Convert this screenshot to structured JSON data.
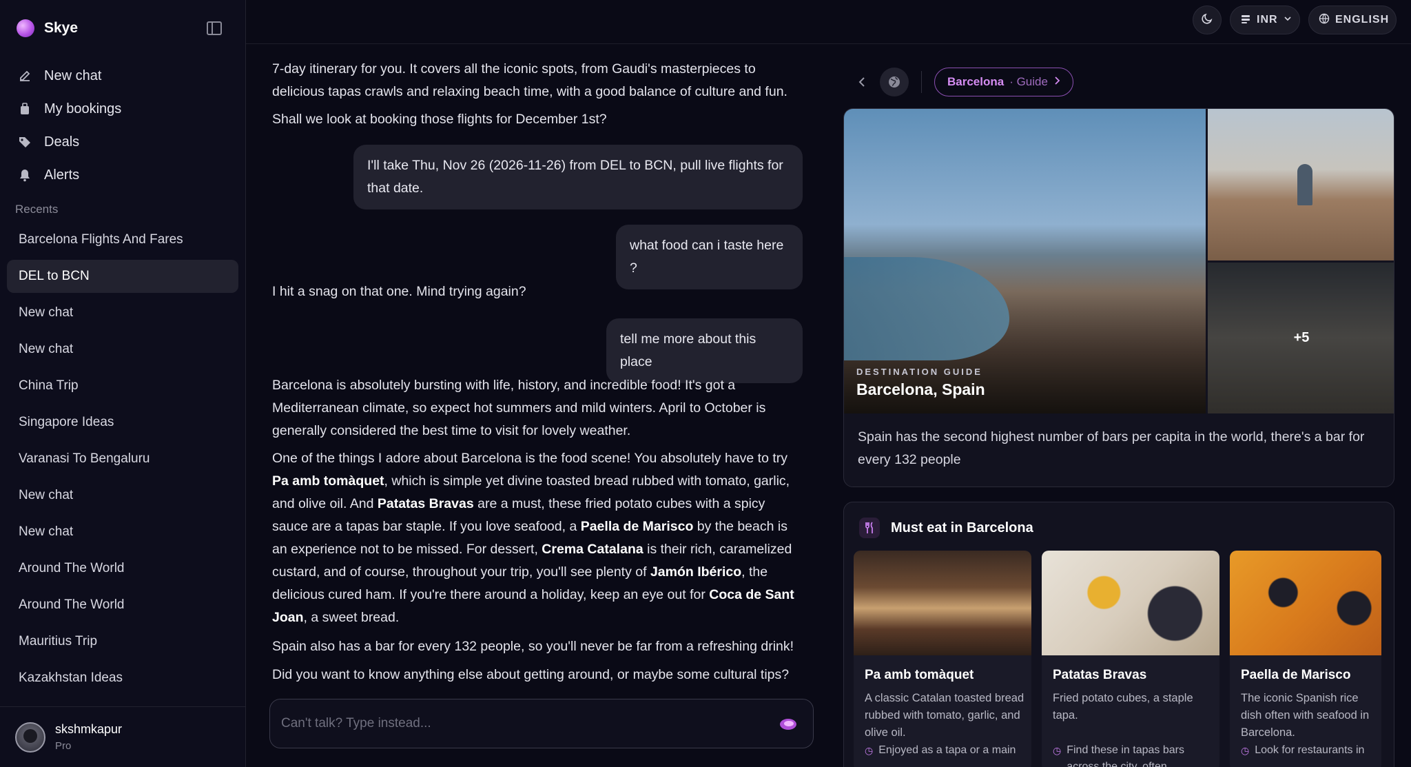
{
  "app": {
    "name": "Skye"
  },
  "nav": [
    {
      "label": "New chat",
      "icon": "edit-icon"
    },
    {
      "label": "My bookings",
      "icon": "suitcase-icon"
    },
    {
      "label": "Deals",
      "icon": "tag-icon"
    },
    {
      "label": "Alerts",
      "icon": "bell-icon"
    }
  ],
  "recents": {
    "label": "Recents",
    "items": [
      "Barcelona Flights And Fares",
      "DEL to BCN",
      "New chat",
      "New chat",
      "China Trip",
      "Singapore Ideas",
      "Varanasi To Bengaluru",
      "New chat",
      "New chat",
      "Around The World",
      "Around The World",
      "Mauritius Trip",
      "Kazakhstan Ideas"
    ],
    "active_index": 1
  },
  "profile": {
    "name": "skshmkapur",
    "plan": "Pro"
  },
  "topbar": {
    "currency": "INR",
    "language": "ENGLISH"
  },
  "chat": {
    "m1": "7-day itinerary for you. It covers all the iconic spots, from Gaudi's masterpieces to delicious tapas crawls and relaxing beach time, with a good balance of culture and fun.",
    "m2": "Shall we look at booking those flights for December 1st?",
    "u1": "I'll take Thu, Nov 26 (2026-11-26) from DEL to BCN, pull live flights for that date.",
    "u2": "what food can i taste here ?",
    "m3": "I hit a snag on that one. Mind trying again?",
    "u3": "tell me more about this place",
    "m4": "Barcelona is absolutely bursting with life, history, and incredible food! It's got a Mediterranean climate, so expect hot summers and mild winters. April to October is generally considered the best time to visit for lovely weather.",
    "m5": {
      "t1": "One of the things I adore about Barcelona is the food scene! You absolutely have to try ",
      "b1": "Pa amb tomàquet",
      "t2": ", which is simple yet divine toasted bread rubbed with tomato, garlic, and olive oil. And ",
      "b2": "Patatas Bravas",
      "t3": " are a must, these fried potato cubes with a spicy sauce are a tapas bar staple. If you love seafood, a ",
      "b3": "Paella de Marisco",
      "t4": " by the beach is an experience not to be missed. For dessert, ",
      "b4": "Crema Catalana",
      "t5": " is their rich, caramelized custard, and of course, throughout your trip, you'll see plenty of ",
      "b5": "Jamón Ibérico",
      "t6": ", the delicious cured ham. If you're there around a holiday, keep an eye out for ",
      "b6": "Coca de Sant Joan",
      "t7": ", a sweet bread."
    },
    "m6": "Spain also has a bar for every 132 people, so you'll never be far from a refreshing drink!",
    "m7": "Did you want to know anything else about getting around, or maybe some cultural tips?",
    "input_placeholder": "Can't talk? Type instead..."
  },
  "panel": {
    "chip_main": "Barcelona",
    "chip_sub": "· Guide",
    "hero_label": "DESTINATION GUIDE",
    "hero_title": "Barcelona, Spain",
    "more_photos": "+5",
    "fact": "Spain has the second highest number of bars per capita in the world, there's a bar for every 132 people",
    "food_title": "Must eat in Barcelona",
    "dishes": [
      {
        "name": "Pa amb tomàquet",
        "desc": "A classic Catalan toasted bread rubbed with tomato, garlic, and olive oil.",
        "tip": "Enjoyed as a tapa or a main"
      },
      {
        "name": "Patatas Bravas",
        "desc": "Fried potato cubes, a staple tapa.",
        "tip": "Find these in tapas bars across the city, often"
      },
      {
        "name": "Paella de Marisco",
        "desc": "The iconic Spanish rice dish often with seafood in Barcelona.",
        "tip": "Look for restaurants in"
      }
    ]
  },
  "colors": {
    "accent": "#c77ded",
    "background": "#0a0a16",
    "bubble": "#22222f"
  }
}
